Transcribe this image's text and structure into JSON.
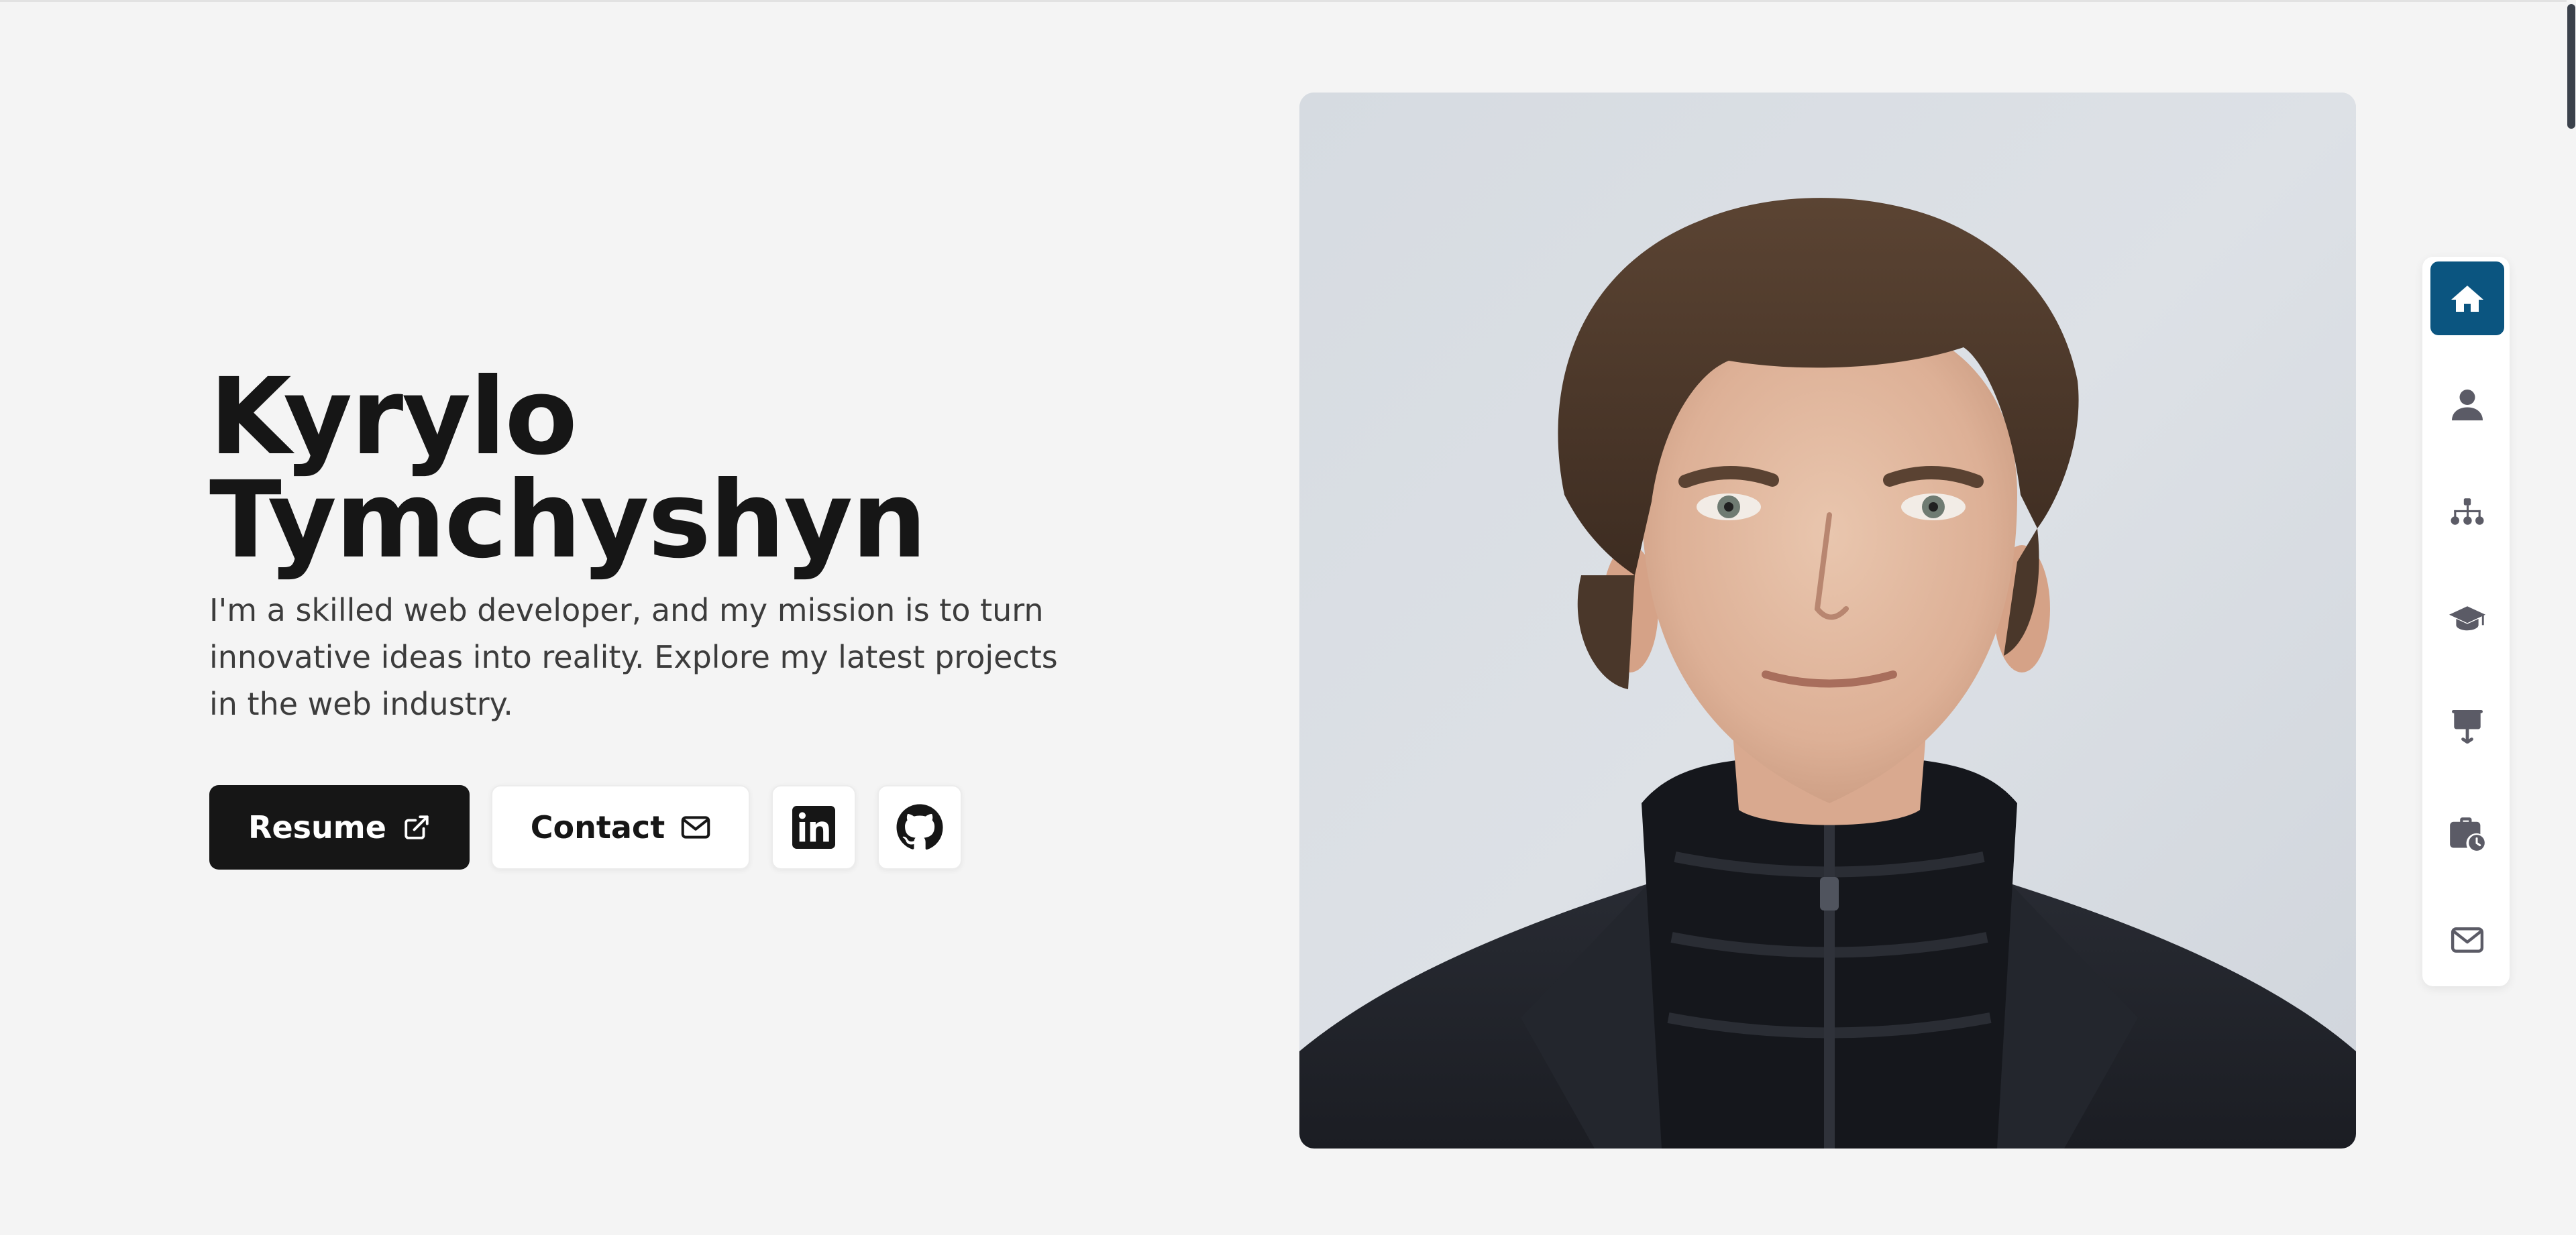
{
  "hero": {
    "name_first": "Kyrylo",
    "name_last": "Tymchyshyn",
    "description": "I'm a skilled web developer, and my mission is to turn innovative ideas into reality. Explore my latest projects in the web industry."
  },
  "actions": {
    "resume_label": "Resume",
    "resume_icon": "external-link-icon",
    "contact_label": "Contact",
    "contact_icon": "envelope-icon",
    "linkedin_icon": "linkedin-icon",
    "github_icon": "github-icon"
  },
  "side_nav": {
    "items": [
      {
        "icon": "home-icon",
        "active": true
      },
      {
        "icon": "user-icon",
        "active": false
      },
      {
        "icon": "sitemap-icon",
        "active": false
      },
      {
        "icon": "graduation-cap-icon",
        "active": false
      },
      {
        "icon": "presentation-icon",
        "active": false
      },
      {
        "icon": "briefcase-clock-icon",
        "active": false
      },
      {
        "icon": "envelope-icon",
        "active": false
      }
    ]
  },
  "colors": {
    "background": "#f4f4f4",
    "text": "#161616",
    "accent": "#0b5580",
    "nav_icon": "#5b5b66"
  }
}
